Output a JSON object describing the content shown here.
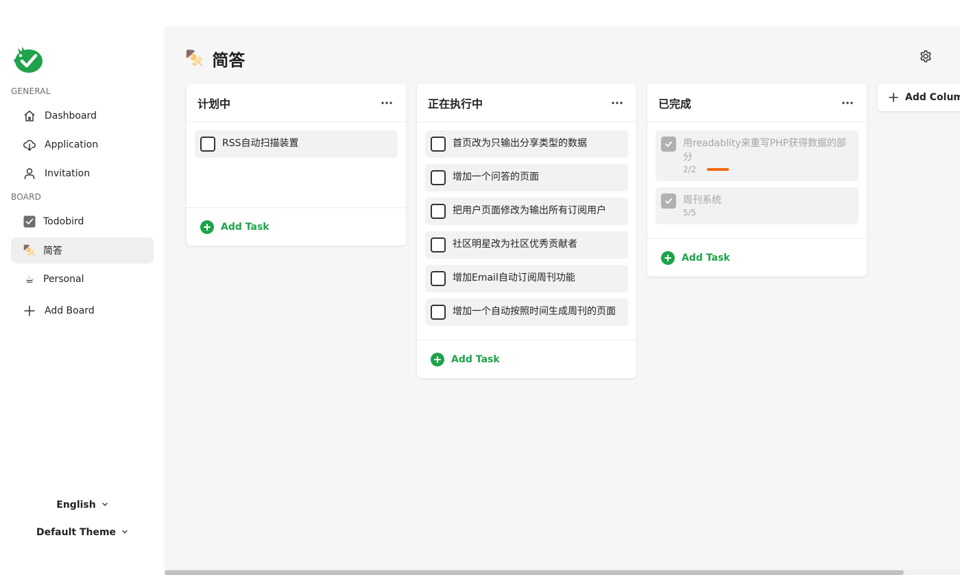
{
  "sidebar": {
    "general_label": "GENERAL",
    "board_label": "BOARD",
    "general_items": [
      {
        "label": "Dashboard",
        "icon": "home-icon"
      },
      {
        "label": "Application",
        "icon": "cloud-download-icon"
      },
      {
        "label": "Invitation",
        "icon": "user-icon"
      }
    ],
    "boards": [
      {
        "label": "Todobird",
        "icon": "checkbox-icon",
        "active": false
      },
      {
        "label": "简答",
        "icon": "skewer-emoji",
        "active": true,
        "glyph": "🍢"
      },
      {
        "label": "Personal",
        "icon": "coffee-emoji",
        "active": false,
        "glyph": "☕"
      }
    ],
    "add_board_label": "Add Board",
    "language": "English",
    "theme": "Default Theme"
  },
  "header": {
    "title": "简答",
    "emoji": "🍢"
  },
  "columns": [
    {
      "title": "计划中",
      "tasks": [
        {
          "text": "RSS自动扫描装置",
          "done": false
        }
      ],
      "add_task_label": "Add Task"
    },
    {
      "title": "正在执行中",
      "tasks": [
        {
          "text": "首页改为只输出分享类型的数据",
          "done": false
        },
        {
          "text": "增加一个问答的页面",
          "done": false
        },
        {
          "text": "把用户页面修改为输出所有订阅用户",
          "done": false
        },
        {
          "text": "社区明星改为社区优秀贡献者",
          "done": false
        },
        {
          "text": "增加Email自动订阅周刊功能",
          "done": false
        },
        {
          "text": "增加一个自动按照时间生成周刊的页面",
          "done": false
        }
      ],
      "add_task_label": "Add Task"
    },
    {
      "title": "已完成",
      "tasks": [
        {
          "text": "用readablity来重写PHP获得数据的部分",
          "done": true,
          "subtasks": "2/2",
          "progress": 1.0
        },
        {
          "text": "周刊系统",
          "done": true,
          "subtasks": "5/5"
        }
      ],
      "add_task_label": "Add Task"
    }
  ],
  "add_column_label": "Add Column",
  "colors": {
    "accent_green": "#1ea34a",
    "progress_orange": "#f06a0f",
    "active_nav_bg": "#efefef"
  }
}
